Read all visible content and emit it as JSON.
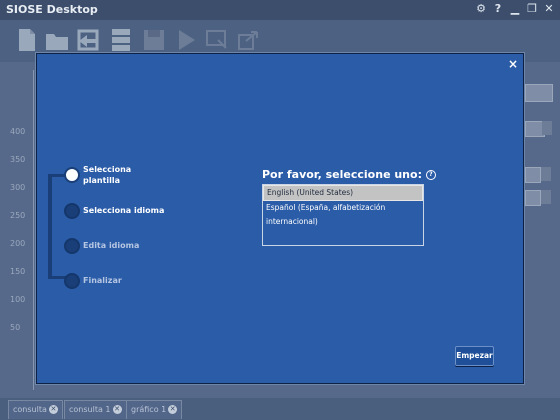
{
  "app": {
    "title": "SIOSE Desktop",
    "window_controls": [
      "settings-icon",
      "help-icon",
      "minimize-icon",
      "restore-icon",
      "close-icon"
    ],
    "toolbar_icons": [
      "new-document-icon",
      "open-folder-icon",
      "import-icon",
      "database-icon",
      "save-icon",
      "play-icon",
      "export-map-icon",
      "share-icon"
    ],
    "y_ticks": [
      "400",
      "350",
      "300",
      "250",
      "200",
      "150",
      "100",
      "50"
    ],
    "tabs": [
      {
        "label": "consulta"
      },
      {
        "label": "consulta 1"
      },
      {
        "label": "gráfico 1"
      }
    ]
  },
  "dialog": {
    "close_label": "×",
    "steps": [
      {
        "label": "Selecciona plantilla",
        "active": true
      },
      {
        "label": "Selecciona idioma",
        "active": false
      },
      {
        "label": "Edita idioma",
        "active": false
      },
      {
        "label": "Finalizar",
        "active": false
      }
    ],
    "prompt": "Por favor, seleccione uno:",
    "help_glyph": "?",
    "languages": [
      {
        "label": "English (United States)",
        "selected": true
      },
      {
        "label": "Español (España, alfabetización internacional)",
        "selected": false
      }
    ],
    "start_button": "Empezar"
  }
}
